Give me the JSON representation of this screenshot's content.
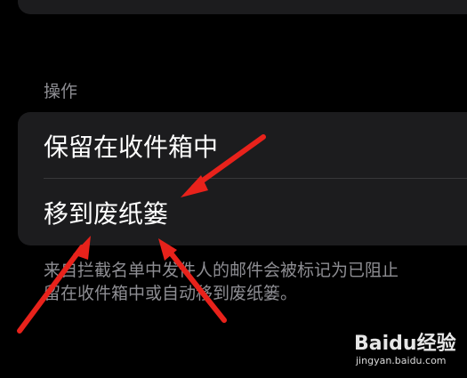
{
  "section": {
    "header": "操作"
  },
  "actions": {
    "options": [
      {
        "label": "保留在收件箱中"
      },
      {
        "label": "移到废纸篓"
      }
    ]
  },
  "footer": {
    "text": "来自拦截名单中发件人的邮件会被标记为已阻止\n留在收件箱中或自动移到废纸篓。"
  },
  "watermark": {
    "logo": "Baidu经验",
    "url": "jingyan.baidu.com"
  },
  "colors": {
    "background": "#000000",
    "card": "#1c1c1e",
    "secondary_text": "#8e8e93",
    "annotation_arrow": "#e8221b"
  }
}
